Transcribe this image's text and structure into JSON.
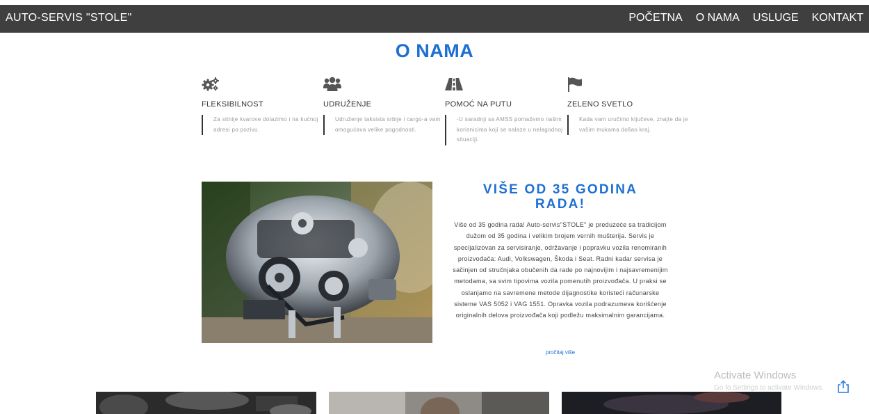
{
  "header": {
    "brand": "AUTO-SERVIS \"STOLE\"",
    "nav": [
      "POČETNA",
      "O NAMA",
      "USLUGE",
      "KONTAKT"
    ]
  },
  "page_title": "O NAMA",
  "features": [
    {
      "icon": "gears-icon",
      "title": "FLEKSIBILNOST",
      "text": "Za sitnije kvarove dolazimo i na kućnoj adresi po pozivu."
    },
    {
      "icon": "users-icon",
      "title": "UDRUŽENJE",
      "text": "Udruženje taksista srbije i cargo-a vam omogućava velike pogodnosti."
    },
    {
      "icon": "road-icon",
      "title": "POMOĆ NA PUTU",
      "text": "-U saradnji sa AMSS pomažemo našim korisnicima koji se nalaze u nelagodnoj situaciji."
    },
    {
      "icon": "flag-icon",
      "title": "ZELENO SVETLO",
      "text": "Kada vam uručimo ključeve, znajte da je vašim mukama došao kraj."
    }
  ],
  "story": {
    "title": "VIŠE OD 35 GODINA RADA!",
    "body": "Više od 35 godina rada! Auto-servis\"STOLE\" je preduzeće sa tradicijom dužom od 35 godina i velikim brojem vernih mušterija. Servis je specijalizovan za servisiranje, održavanje i popravku vozila renomiranih proizvođača: Audi, Volkswagen, Škoda i Seat. Radni kadar servisa je sačinjen od stručnjaka obučenih da rade po najnovijim i najsavremenijim metodama, sa svim tipovima vozila pomenutih proizvođača. U praksi se oslanjamo na savremene metode dijagnostike koristeći računarske sisteme VAS 5052 i VAG 1551. Opravka vozila podrazumeva korišćenje originalnih delova proizvođača koji podležu maksimalnim garancijama.",
    "read_more": "pročitaj više"
  },
  "watermark": {
    "line1": "Activate Windows",
    "line2": "Go to Settings to activate Windows."
  }
}
